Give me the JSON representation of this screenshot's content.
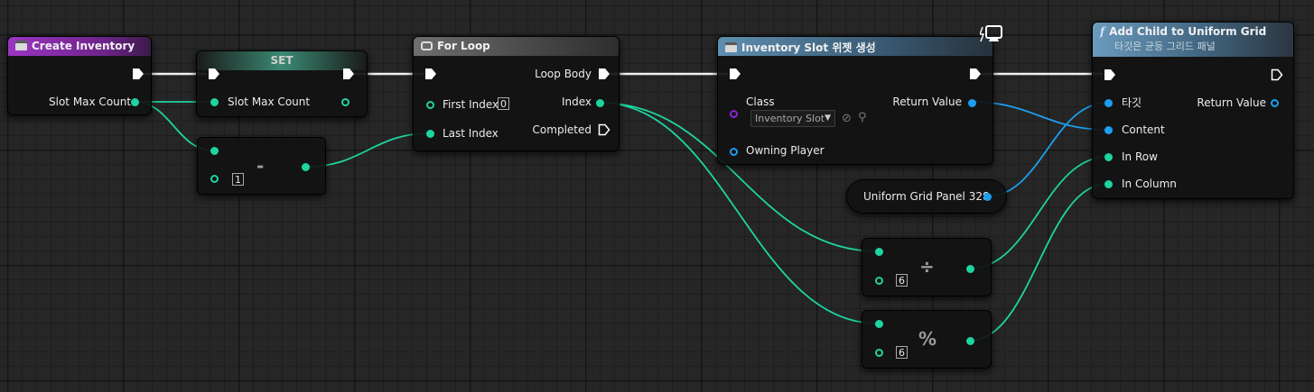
{
  "nodes": {
    "create_inventory": {
      "title": "Create Inventory",
      "out_label": "Slot Max Count"
    },
    "set": {
      "title": "SET",
      "in_label": "Slot Max Count"
    },
    "subtract": {
      "symbol": "-",
      "b_value": "1"
    },
    "for_loop": {
      "title": "For Loop",
      "first_index_label": "First Index",
      "first_index_value": "0",
      "last_index_label": "Last Index",
      "loop_body_label": "Loop Body",
      "index_label": "Index",
      "completed_label": "Completed"
    },
    "create_widget": {
      "title": "Inventory Slot 위젯 생성",
      "class_label": "Class",
      "class_value": "Inventory Slot",
      "owning_player_label": "Owning Player",
      "return_value_label": "Return Value"
    },
    "grid_panel": {
      "label": "Uniform Grid Panel 328"
    },
    "divide": {
      "symbol": "÷",
      "b_value": "6"
    },
    "modulo": {
      "symbol": "%",
      "b_value": "6"
    },
    "add_child": {
      "title": "Add Child to Uniform Grid",
      "subtitle": "타깃은 균등 그리드 패널",
      "target_label": "타깃",
      "content_label": "Content",
      "in_row_label": "In Row",
      "in_column_label": "In Column",
      "return_value_label": "Return Value"
    }
  },
  "colors": {
    "event_header": "#8d2bb0",
    "set_header": "#3b8a73",
    "macro_header": "#5a5a5a",
    "function_header": "#5a88a6",
    "float_pin": "#1ed4a0",
    "object_pin": "#1b9fee",
    "class_pin": "#8a24d8"
  }
}
